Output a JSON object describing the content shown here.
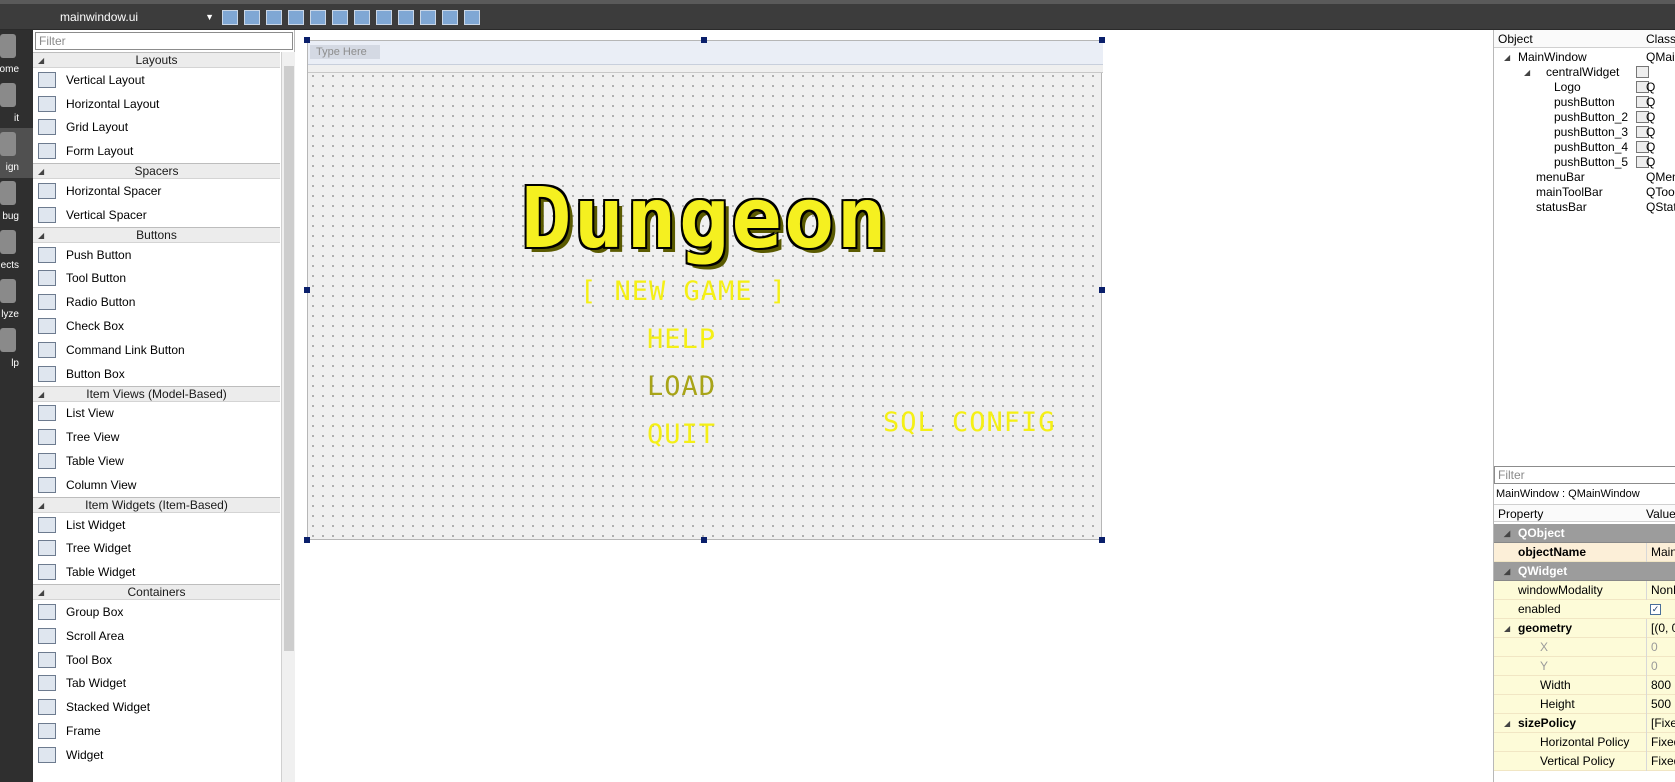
{
  "toolbar": {
    "file": "mainwindow.ui",
    "icons": [
      "edit-widgets-icon",
      "edit-signals-icon",
      "edit-buddies-icon",
      "edit-tab-order-icon",
      "layout-horizontal-icon",
      "layout-vertical-icon",
      "layout-split-horizontal-icon",
      "layout-split-vertical-icon",
      "layout-form-icon",
      "layout-grid-icon",
      "break-layout-icon",
      "adjust-size-icon"
    ]
  },
  "modes": [
    {
      "label": "ome",
      "active": false
    },
    {
      "label": "it",
      "active": false
    },
    {
      "label": "ign",
      "active": true
    },
    {
      "label": "bug",
      "active": false
    },
    {
      "label": "ects",
      "active": false
    },
    {
      "label": "lyze",
      "active": false
    },
    {
      "label": "lp",
      "active": false
    }
  ],
  "widget_box": {
    "filter_placeholder": "Filter",
    "categories": [
      {
        "name": "Layouts",
        "items": [
          "Vertical Layout",
          "Horizontal Layout",
          "Grid Layout",
          "Form Layout"
        ]
      },
      {
        "name": "Spacers",
        "items": [
          "Horizontal Spacer",
          "Vertical Spacer"
        ]
      },
      {
        "name": "Buttons",
        "items": [
          "Push Button",
          "Tool Button",
          "Radio Button",
          "Check Box",
          "Command Link Button",
          "Button Box"
        ]
      },
      {
        "name": "Item Views (Model-Based)",
        "items": [
          "List View",
          "Tree View",
          "Table View",
          "Column View"
        ]
      },
      {
        "name": "Item Widgets (Item-Based)",
        "items": [
          "List Widget",
          "Tree Widget",
          "Table Widget"
        ]
      },
      {
        "name": "Containers",
        "items": [
          "Group Box",
          "Scroll Area",
          "Tool Box",
          "Tab Widget",
          "Stacked Widget",
          "Frame",
          "Widget"
        ]
      }
    ]
  },
  "form": {
    "type_here": "Type Here",
    "logo": "Dungeon",
    "buttons": {
      "new_game": "[ NEW GAME ]",
      "help": "HELP",
      "load": "LOAD",
      "quit": "QUIT",
      "sql_config": "SQL CONFIG"
    }
  },
  "object_inspector": {
    "col_object": "Object",
    "col_class": "Class",
    "rows": [
      {
        "name": "MainWindow",
        "cls": "QMai"
      },
      {
        "name": "centralWidget",
        "cls": ""
      },
      {
        "name": "Logo",
        "cls": "Q"
      },
      {
        "name": "pushButton",
        "cls": "Q"
      },
      {
        "name": "pushButton_2",
        "cls": "Q"
      },
      {
        "name": "pushButton_3",
        "cls": "Q"
      },
      {
        "name": "pushButton_4",
        "cls": "Q"
      },
      {
        "name": "pushButton_5",
        "cls": "Q"
      },
      {
        "name": "menuBar",
        "cls": "QMen"
      },
      {
        "name": "mainToolBar",
        "cls": "QTool"
      },
      {
        "name": "statusBar",
        "cls": "QStat"
      }
    ]
  },
  "property_editor": {
    "filter_placeholder": "Filter",
    "title": "MainWindow : QMainWindow",
    "col_property": "Property",
    "col_value": "Value",
    "rows": [
      {
        "name": "QObject",
        "value": ""
      },
      {
        "name": "objectName",
        "value": "Main"
      },
      {
        "name": "QWidget",
        "value": ""
      },
      {
        "name": "windowModality",
        "value": "NonM"
      },
      {
        "name": "enabled",
        "value": ""
      },
      {
        "name": "geometry",
        "value": "[(0, 0"
      },
      {
        "name": "X",
        "value": "0"
      },
      {
        "name": "Y",
        "value": "0"
      },
      {
        "name": "Width",
        "value": "800"
      },
      {
        "name": "Height",
        "value": "500"
      },
      {
        "name": "sizePolicy",
        "value": "[Fixed"
      },
      {
        "name": "Horizontal Policy",
        "value": "Fixed"
      },
      {
        "name": "Vertical Policy",
        "value": "Fixed"
      }
    ]
  }
}
